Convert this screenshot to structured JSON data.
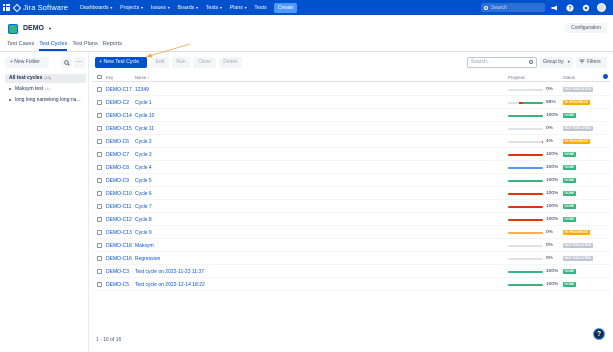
{
  "topnav": {
    "logo": "Jira Software",
    "menu": [
      {
        "label": "Dashboards",
        "caret": true
      },
      {
        "label": "Projects",
        "caret": true
      },
      {
        "label": "Issues",
        "caret": true
      },
      {
        "label": "Boards",
        "caret": true
      },
      {
        "label": "Tests",
        "caret": true
      },
      {
        "label": "Plans",
        "caret": true
      },
      {
        "label": "Tests",
        "caret": false
      }
    ],
    "create": "Create",
    "search_placeholder": "Search",
    "icons": [
      "megaphone-icon",
      "help-icon",
      "settings-icon",
      "avatar"
    ]
  },
  "project": {
    "name": "DEMO",
    "config": "Configuration"
  },
  "tabs": [
    {
      "label": "Test Cases",
      "active": false
    },
    {
      "label": "Test Cycles",
      "active": true
    },
    {
      "label": "Test Plans",
      "active": false
    },
    {
      "label": "Reports",
      "active": false
    }
  ],
  "sidebar": {
    "new_folder": "+ New Folder",
    "all_label": "All test cycles",
    "all_count": "(16)",
    "folders": [
      {
        "label": "Maksym test",
        "count": "(1)"
      },
      {
        "label": "long long namelong long na...",
        "count": ""
      }
    ]
  },
  "toolbar": {
    "new_cycle": "+ New Test Cycle",
    "buttons": [
      "Edit",
      "Run",
      "Clone",
      "Delete"
    ],
    "search_placeholder": "Search...",
    "group_by": "Group by",
    "filters": "Filters"
  },
  "table": {
    "headers": {
      "key": "Key",
      "name": "Name",
      "progress": "Progress",
      "status": "Status"
    },
    "rows": [
      {
        "key": "DEMO-C17",
        "name": "12349",
        "progress": [
          {
            "c": "#dfe1e6",
            "v": 1.0
          }
        ],
        "pct": "0%",
        "status": "NOT EXECUTED",
        "scolor": "#c1c7d0"
      },
      {
        "key": "DEMO-C2",
        "name": "Cycle 1",
        "progress": [
          {
            "c": "#dfe1e6",
            "v": 0.32
          },
          {
            "c": "#de350b",
            "v": 0.12
          },
          {
            "c": "#36b37e",
            "v": 0.56
          }
        ],
        "pct": "68%",
        "status": "IN PROGRESS",
        "scolor": "#ffab00"
      },
      {
        "key": "DEMO-C14",
        "name": "Cycle 10",
        "progress": [
          {
            "c": "#36b37e",
            "v": 1.0
          }
        ],
        "pct": "100%",
        "status": "DONE",
        "scolor": "#36b37e"
      },
      {
        "key": "DEMO-C15",
        "name": "Cycle 11",
        "progress": [
          {
            "c": "#dfe1e6",
            "v": 1.0
          }
        ],
        "pct": "0%",
        "status": "NOT EXECUTED",
        "scolor": "#c1c7d0"
      },
      {
        "key": "DEMO-C6",
        "name": "Cycle 2",
        "progress": [
          {
            "c": "#dfe1e6",
            "v": 0.96
          },
          {
            "c": "#de350b",
            "v": 0.04
          }
        ],
        "pct": "4%",
        "status": "IN PROGRESS",
        "scolor": "#ffab00"
      },
      {
        "key": "DEMO-C7",
        "name": "Cycle 3",
        "progress": [
          {
            "c": "#de350b",
            "v": 1.0
          }
        ],
        "pct": "100%",
        "status": "DONE",
        "scolor": "#36b37e"
      },
      {
        "key": "DEMO-C8",
        "name": "Cycle 4",
        "progress": [
          {
            "c": "#4c9aff",
            "v": 1.0
          }
        ],
        "pct": "100%",
        "status": "DONE",
        "scolor": "#36b37e"
      },
      {
        "key": "DEMO-C9",
        "name": "Cycle 5",
        "progress": [
          {
            "c": "#36b37e",
            "v": 1.0
          }
        ],
        "pct": "100%",
        "status": "DONE",
        "scolor": "#36b37e"
      },
      {
        "key": "DEMO-C10",
        "name": "Cycle 6",
        "progress": [
          {
            "c": "#de350b",
            "v": 1.0
          }
        ],
        "pct": "100%",
        "status": "DONE",
        "scolor": "#36b37e"
      },
      {
        "key": "DEMO-C11",
        "name": "Cycle 7",
        "progress": [
          {
            "c": "#de350b",
            "v": 1.0
          }
        ],
        "pct": "100%",
        "status": "DONE",
        "scolor": "#36b37e"
      },
      {
        "key": "DEMO-C12",
        "name": "Cycle 8",
        "progress": [
          {
            "c": "#de350b",
            "v": 1.0
          }
        ],
        "pct": "100%",
        "status": "DONE",
        "scolor": "#36b37e"
      },
      {
        "key": "DEMO-C13",
        "name": "Cycle 9",
        "progress": [
          {
            "c": "#f6b04f",
            "v": 1.0
          }
        ],
        "pct": "0%",
        "status": "IN PROGRESS",
        "scolor": "#ffab00"
      },
      {
        "key": "DEMO-C18",
        "name": "Maksym",
        "progress": [
          {
            "c": "#dfe1e6",
            "v": 1.0
          }
        ],
        "pct": "0%",
        "status": "NOT EXECUTED",
        "scolor": "#c1c7d0"
      },
      {
        "key": "DEMO-C16",
        "name": "Regression",
        "progress": [
          {
            "c": "#dfe1e6",
            "v": 1.0
          }
        ],
        "pct": "0%",
        "status": "NOT EXECUTED",
        "scolor": "#c1c7d0"
      },
      {
        "key": "DEMO-C3",
        "name": "Test cycle on 2022-11-23 11:37",
        "progress": [
          {
            "c": "#36b37e",
            "v": 1.0
          }
        ],
        "pct": "100%",
        "status": "DONE",
        "scolor": "#36b37e"
      },
      {
        "key": "DEMO-C5",
        "name": "Test cycle on 2022-12-14 18:22",
        "progress": [
          {
            "c": "#36b37e",
            "v": 1.0
          }
        ],
        "pct": "100%",
        "status": "DONE",
        "scolor": "#36b37e"
      }
    ]
  },
  "pagination": "1 - 16 of 16",
  "help": "?"
}
